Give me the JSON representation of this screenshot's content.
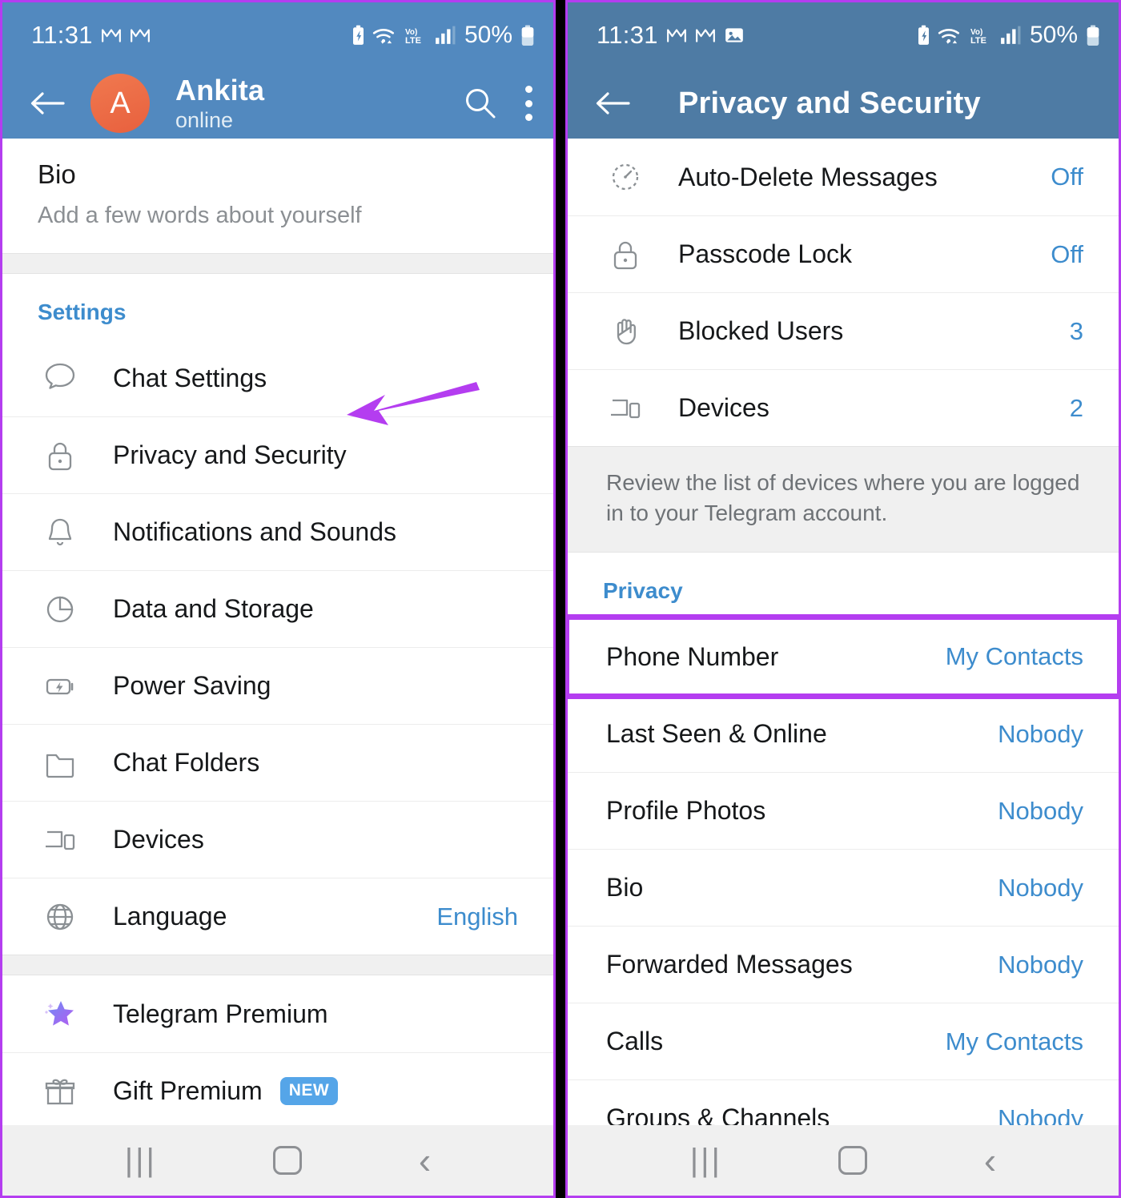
{
  "theme": {
    "header_left_bg": "#5289bf",
    "header_right_bg": "#4e7ba4",
    "accent_blue": "#3d8ccd",
    "highlight_purple": "#b43df0",
    "avatar_bg": "#e8603e",
    "badge_blue": "#55a5e8"
  },
  "left_screen": {
    "status_bar": {
      "time": "11:31",
      "battery_percent": "50%",
      "network": "LTE",
      "icons": [
        "gmail-icon",
        "gmail-icon",
        "battery-saver-icon",
        "wifi-icon",
        "volte-icon",
        "signal-icon",
        "battery-icon"
      ]
    },
    "app_bar": {
      "back_label": "Back",
      "avatar_initial": "A",
      "title": "Ankita",
      "subtitle": "online",
      "search_label": "Search",
      "menu_label": "More options"
    },
    "bio": {
      "title": "Bio",
      "subtitle": "Add a few words about yourself"
    },
    "settings_section": {
      "header": "Settings",
      "items": [
        {
          "icon": "chat-bubble-icon",
          "label": "Chat Settings",
          "value": ""
        },
        {
          "icon": "lock-icon",
          "label": "Privacy and Security",
          "value": ""
        },
        {
          "icon": "bell-icon",
          "label": "Notifications and Sounds",
          "value": ""
        },
        {
          "icon": "pie-chart-icon",
          "label": "Data and Storage",
          "value": ""
        },
        {
          "icon": "battery-bolt-icon",
          "label": "Power Saving",
          "value": ""
        },
        {
          "icon": "folder-icon",
          "label": "Chat Folders",
          "value": ""
        },
        {
          "icon": "devices-icon",
          "label": "Devices",
          "value": ""
        },
        {
          "icon": "globe-icon",
          "label": "Language",
          "value": "English"
        }
      ]
    },
    "premium_section": {
      "items": [
        {
          "icon": "premium-star-icon",
          "label": "Telegram Premium",
          "badge": ""
        },
        {
          "icon": "gift-icon",
          "label": "Gift Premium",
          "badge": "NEW"
        }
      ]
    },
    "annotation": {
      "type": "arrow",
      "points_to": "Privacy and Security"
    },
    "nav_bar": {
      "recents": "|||",
      "home": "home-icon",
      "back": "‹"
    }
  },
  "right_screen": {
    "status_bar": {
      "time": "11:31",
      "battery_percent": "50%",
      "network": "LTE",
      "icons": [
        "gmail-icon",
        "gmail-icon",
        "image-icon",
        "battery-saver-icon",
        "wifi-icon",
        "volte-icon",
        "signal-icon",
        "battery-icon"
      ]
    },
    "app_bar": {
      "back_label": "Back",
      "title": "Privacy and Security"
    },
    "security_section": {
      "items": [
        {
          "icon": "auto-delete-timer-icon",
          "label": "Auto-Delete Messages",
          "value": "Off"
        },
        {
          "icon": "lock-icon",
          "label": "Passcode Lock",
          "value": "Off"
        },
        {
          "icon": "hand-stop-icon",
          "label": "Blocked Users",
          "value": "3"
        },
        {
          "icon": "devices-icon",
          "label": "Devices",
          "value": "2"
        }
      ],
      "note": "Review the list of devices where you are logged in to your Telegram account."
    },
    "privacy_section": {
      "header": "Privacy",
      "items": [
        {
          "label": "Phone Number",
          "value": "My Contacts",
          "highlighted": true
        },
        {
          "label": "Last Seen & Online",
          "value": "Nobody",
          "highlighted": false
        },
        {
          "label": "Profile Photos",
          "value": "Nobody",
          "highlighted": false
        },
        {
          "label": "Bio",
          "value": "Nobody",
          "highlighted": false
        },
        {
          "label": "Forwarded Messages",
          "value": "Nobody",
          "highlighted": false
        },
        {
          "label": "Calls",
          "value": "My Contacts",
          "highlighted": false
        },
        {
          "label": "Groups & Channels",
          "value": "Nobody",
          "highlighted": false
        }
      ]
    },
    "nav_bar": {
      "recents": "|||",
      "home": "home-icon",
      "back": "‹"
    }
  }
}
